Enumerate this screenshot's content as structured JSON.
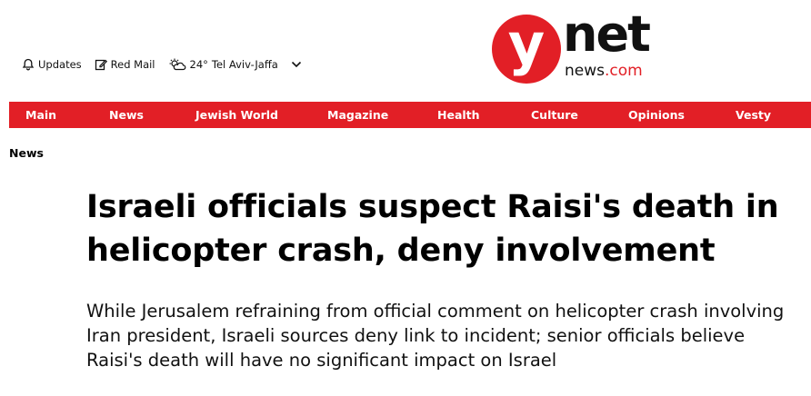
{
  "utility": {
    "updates_label": "Updates",
    "redmail_label": "Red Mail",
    "temperature": "24°",
    "city": "Tel Aviv-Jaffa"
  },
  "logo": {
    "letter": "y",
    "word": "net",
    "sub_name": "news",
    "sub_domain": ".com"
  },
  "nav": {
    "items": [
      "Main",
      "News",
      "Jewish World",
      "Magazine",
      "Health",
      "Culture",
      "Opinions",
      "Vesty"
    ]
  },
  "article": {
    "section": "News",
    "headline": "Israeli officials suspect Raisi's death in helicopter crash, deny involvement",
    "subtitle": "While Jerusalem refraining from official comment on helicopter crash involving Iran president, Israeli sources deny link to incident; senior officials believe Raisi's death will have no significant impact on Israel"
  },
  "colors": {
    "brand_red": "#e21f26",
    "text": "#111111"
  },
  "icons": [
    "bell-icon",
    "edit-icon",
    "weather-icon",
    "chevron-down-icon"
  ]
}
